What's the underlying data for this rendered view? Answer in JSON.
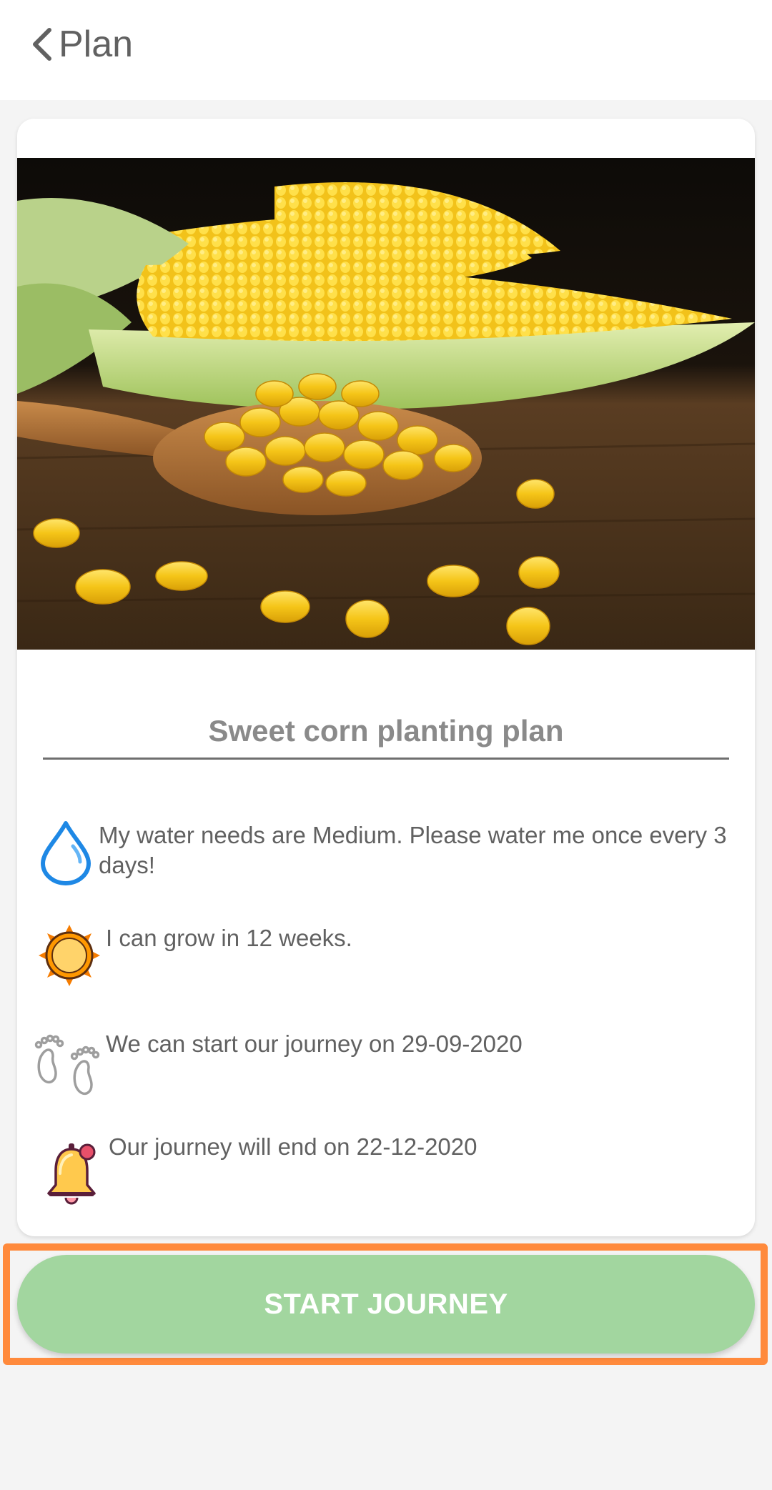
{
  "header": {
    "title": "Plan",
    "back_icon": "chevron-left-icon"
  },
  "plan": {
    "image": "sweet-corn-photo",
    "title": "Sweet corn planting plan",
    "info": [
      {
        "icon": "water-drop-icon",
        "text": "My water needs are Medium. Please water me once every 3 days!"
      },
      {
        "icon": "sun-icon",
        "text": "I can grow in 12 weeks."
      },
      {
        "icon": "footprints-icon",
        "text": "We can start our journey on 29-09-2020"
      },
      {
        "icon": "bell-icon",
        "text": "Our journey will end on 22-12-2020"
      }
    ]
  },
  "actions": {
    "start_label": "START JOURNEY"
  },
  "colors": {
    "button": "#a2d69f",
    "highlight": "#ff8a3c",
    "water": "#1e88e5",
    "sun": "#f57c00"
  }
}
